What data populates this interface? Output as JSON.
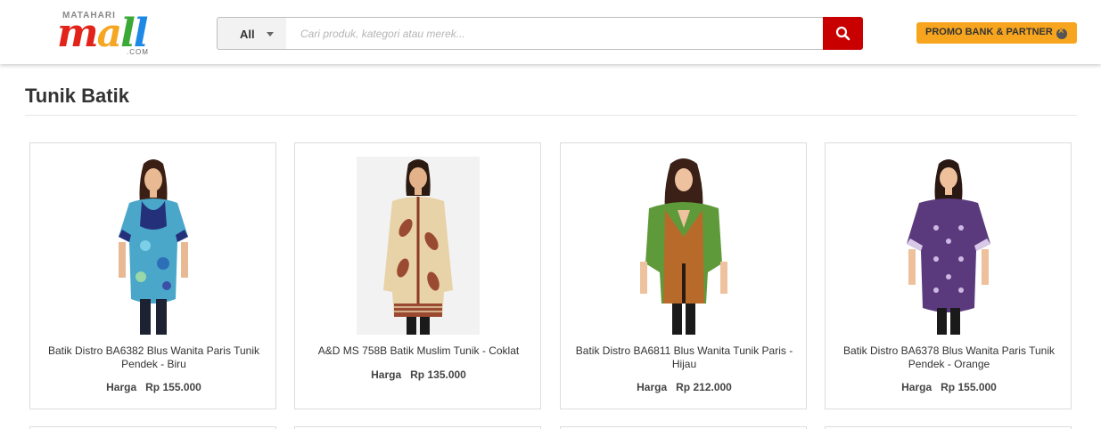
{
  "header": {
    "logo": {
      "top_text": "MATAHARI",
      "word": "mall",
      "suffix": ".COM"
    },
    "search": {
      "category": "All",
      "placeholder": "Cari produk, kategori atau merek..."
    },
    "promo_label": "PROMO BANK & PARTNER"
  },
  "page": {
    "title": "Tunik Batik",
    "price_label": "Harga"
  },
  "products": [
    {
      "name": "Batik Distro BA6382 Blus Wanita Paris Tunik Pendek - Biru",
      "price": "Rp 155.000"
    },
    {
      "name": "A&D MS 758B Batik Muslim Tunik - Coklat",
      "price": "Rp 135.000"
    },
    {
      "name": "Batik Distro BA6811 Blus Wanita Tunik Paris - Hijau",
      "price": "Rp 212.000"
    },
    {
      "name": "Batik Distro BA6378 Blus Wanita Paris Tunik Pendek - Orange",
      "price": "Rp 155.000"
    }
  ],
  "colors": {
    "search_button": "#c80000",
    "promo_bg": "#f7a51e",
    "brand_red": "#e2231a"
  },
  "icons": {
    "search": "search-icon",
    "caret": "chevron-down-icon",
    "promo": "close-circle-icon"
  }
}
